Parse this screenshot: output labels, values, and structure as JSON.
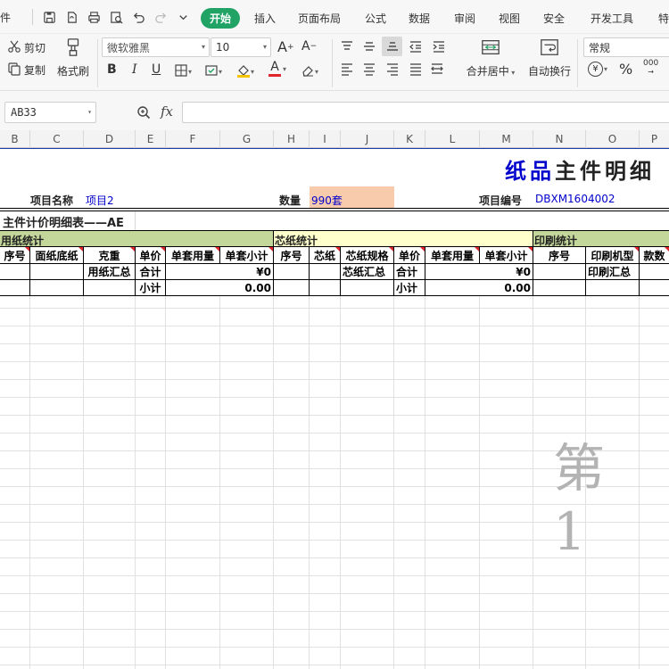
{
  "menu": {
    "file_partial": "件",
    "tabs": [
      "开始",
      "插入",
      "页面布局",
      "公式",
      "数据",
      "审阅",
      "视图",
      "安全",
      "开发工具",
      "特"
    ]
  },
  "ribbon": {
    "cut": "剪切",
    "copy": "复制",
    "format_painter": "格式刷",
    "font_name": "微软雅黑",
    "font_size": "10",
    "merge_center": "合并居中",
    "wrap_text": "自动换行",
    "number_format": "常规",
    "currency_symbol": "¥",
    "percent_symbol": "%",
    "thousands_symbol": "000",
    "bold": "B",
    "italic": "I",
    "underline": "U"
  },
  "formula_bar": {
    "cell_ref": "AB33",
    "fx": "fx",
    "content": ""
  },
  "columns": [
    "B",
    "C",
    "D",
    "E",
    "F",
    "G",
    "H",
    "I",
    "J",
    "K",
    "L",
    "M",
    "N",
    "O",
    "P"
  ],
  "sheet": {
    "title": "纸品主件明细",
    "project_name_label": "项目名称",
    "project_name_value": "项目2",
    "quantity_label": "数量",
    "quantity_value": "990套",
    "project_no_label": "项目编号",
    "project_no_value": "DBXM1604002",
    "section_title": "主件计价明细表——AE",
    "group_paper": "用纸统计",
    "group_core": "芯纸统计",
    "group_print": "印刷统计",
    "headers": [
      "序号",
      "面纸底纸",
      "克重",
      "单价",
      "单套用量",
      "单套小计",
      "序号",
      "芯纸",
      "芯纸规格",
      "单价",
      "单套用量",
      "单套小计",
      "序号",
      "印刷机型",
      "款数"
    ],
    "row1": {
      "paper_total_label": "用纸汇总",
      "paper_sum_label": "合计",
      "paper_sum_value": "¥0",
      "core_total_label": "芯纸汇总",
      "core_sum_label": "合计",
      "core_sum_value": "¥0",
      "print_total_label": "印刷汇总"
    },
    "row2": {
      "paper_subtotal_label": "小计",
      "paper_subtotal_value": "0.00",
      "core_subtotal_label": "小计",
      "core_subtotal_value": "0.00"
    },
    "watermark": "第 1"
  },
  "colors": {
    "accent": "#21a366",
    "group_green": "#c4d79b",
    "group_yellow": "#ffffcc",
    "quantity_fill": "#f8cbad",
    "blue_text": "#0000cc",
    "title_blue": "#0000cc"
  }
}
